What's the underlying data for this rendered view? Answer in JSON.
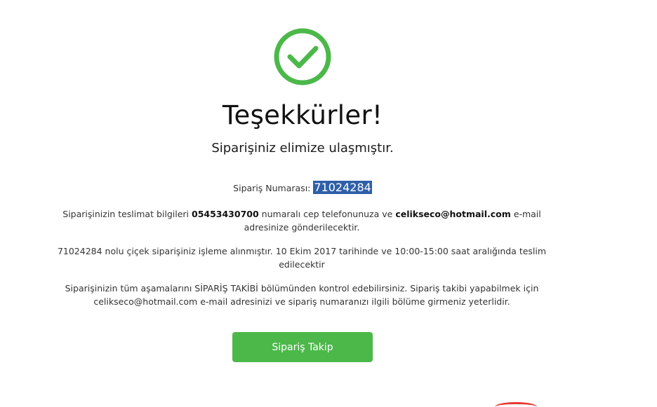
{
  "header": {
    "icon": "check-circle-icon",
    "icon_color": "#4cb84a",
    "title": "Teşekkürler!",
    "subtitle": "Siparişiniz elimize ulaşmıştır."
  },
  "order": {
    "label": "Sipariş Numarası:",
    "number": "71024284",
    "number_highlight_color": "#2f5fa8"
  },
  "delivery_info": {
    "part1": "Siparişinizin teslimat bilgileri",
    "phone": "05453430700",
    "part2": "numaralı cep telefonunuza ve",
    "email": "celikseco@hotmail.com",
    "part3": "e-mail adresinize gönderilecektir."
  },
  "processing_info": {
    "text": "71024284 nolu çiçek siparişiniz işleme alınmıştır. 10 Ekim 2017 tarihinde ve 10:00-15:00 saat aralığında teslim edilecektir"
  },
  "tracking_info": {
    "text": "Siparişinizin tüm aşamalarını SİPARİŞ TAKİBİ bölümünden kontrol edebilirsiniz. Sipariş takibi yapabilmek için celikseco@hotmail.com e-mail adresinizi ve sipariş numaranızı ilgili bölüme girmeniz yeterlidir."
  },
  "actions": {
    "track_button_label": "Sipariş Takip",
    "button_color": "#4cb84a"
  }
}
